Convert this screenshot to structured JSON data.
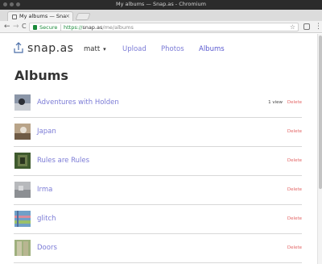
{
  "window": {
    "title": "My albums — Snap.as - Chromium"
  },
  "browser": {
    "tab_title": "My albums — Snap",
    "tab_close": "×",
    "secure_label": "Secure",
    "url_scheme": "https://",
    "url_host": "snap.as",
    "url_path": "/me/albums",
    "back_glyph": "←",
    "forward_glyph": "→",
    "reload_glyph": "C",
    "star_glyph": "☆",
    "menu_glyph": "⋮"
  },
  "site": {
    "brand": "snap.as",
    "user": "matt",
    "user_chevron": "▾",
    "nav": [
      {
        "label": "Upload"
      },
      {
        "label": "Photos"
      },
      {
        "label": "Albums"
      }
    ]
  },
  "page": {
    "title": "Albums"
  },
  "albums": [
    {
      "name": "Adventures with Holden",
      "views": "1 view",
      "delete_label": "Delete"
    },
    {
      "name": "Japan",
      "views": "",
      "delete_label": "Delete"
    },
    {
      "name": "Rules are Rules",
      "views": "",
      "delete_label": "Delete"
    },
    {
      "name": "Irma",
      "views": "",
      "delete_label": "Delete"
    },
    {
      "name": "glitch",
      "views": "",
      "delete_label": "Delete"
    },
    {
      "name": "Doors",
      "views": "",
      "delete_label": "Delete"
    }
  ],
  "colors": {
    "link": "#7b7bd6",
    "delete": "#e36464",
    "secure": "#1a8a3a"
  }
}
